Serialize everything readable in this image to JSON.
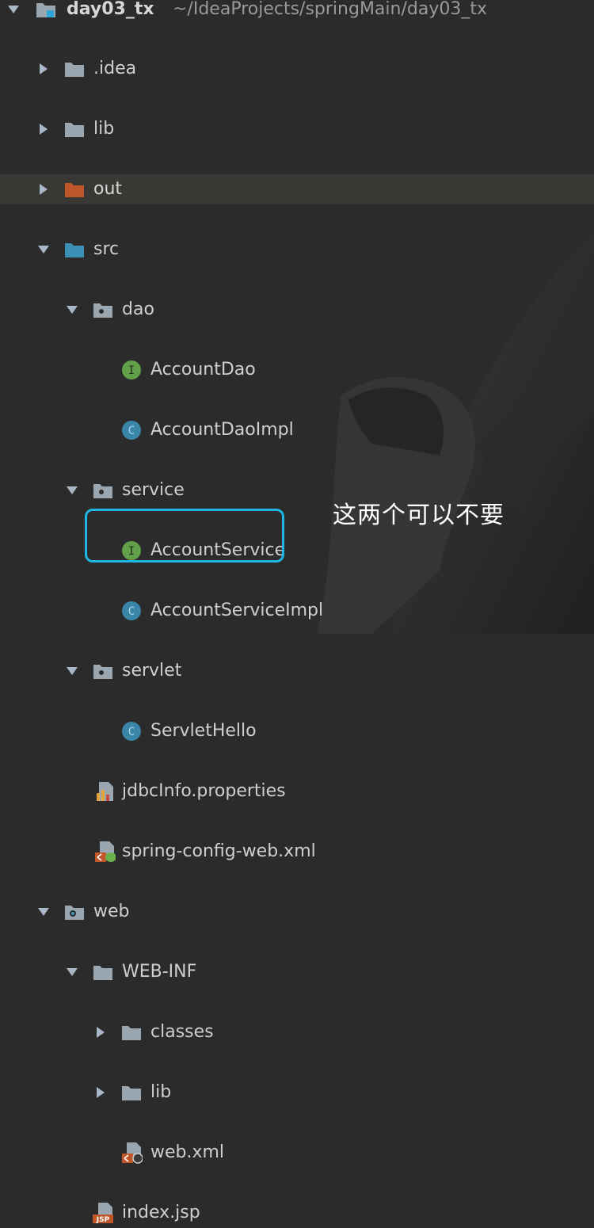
{
  "tree": {
    "root": {
      "name": "day03_tx",
      "path": "~/IdeaProjects/springMain/day03_tx"
    },
    "items": [
      {
        "label": ".idea"
      },
      {
        "label": "lib"
      },
      {
        "label": "out"
      },
      {
        "label": "src"
      },
      {
        "label": "dao"
      },
      {
        "label": "AccountDao"
      },
      {
        "label": "AccountDaoImpl"
      },
      {
        "label": "service"
      },
      {
        "label": "AccountService"
      },
      {
        "label": "AccountServiceImpl"
      },
      {
        "label": "servlet"
      },
      {
        "label": "ServletHello"
      },
      {
        "label": "jdbcInfo.properties"
      },
      {
        "label": "spring-config-web.xml"
      },
      {
        "label": "web"
      },
      {
        "label": "WEB-INF"
      },
      {
        "label": "classes"
      },
      {
        "label": "lib"
      },
      {
        "label": "web.xml"
      },
      {
        "label": "index.jsp"
      }
    ]
  },
  "icons": {
    "interface_badge": "I",
    "class_badge": "C",
    "jsp_badge": "JSP"
  },
  "annotation": {
    "text": "这两个可以不要"
  },
  "colors": {
    "background": "#2b2b2b",
    "selected_row": "#3a3834",
    "folder_gray": "#9aa7b0",
    "folder_out": "#c0572b",
    "folder_src": "#3c8fb5",
    "interface_green": "#62a04a",
    "class_blue": "#3a86a8",
    "annotation_border": "#1fb6e6"
  }
}
